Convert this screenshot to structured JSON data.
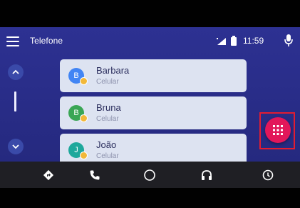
{
  "header": {
    "title": "Telefone",
    "time": "11:59",
    "menu_icon": "menu-icon",
    "signal_icon": "signal-icon",
    "battery_icon": "battery-icon",
    "mic_icon": "microphone-icon"
  },
  "scroll": {
    "up_icon": "chevron-up-icon",
    "down_icon": "chevron-down-icon"
  },
  "contacts": [
    {
      "name": "Barbara",
      "type": "Celular",
      "initial": "B",
      "color": "#4285f4"
    },
    {
      "name": "Bruna",
      "type": "Celular",
      "initial": "B",
      "color": "#3aa655"
    },
    {
      "name": "João",
      "type": "Celular",
      "initial": "J",
      "color": "#1ea89c"
    }
  ],
  "fab": {
    "icon": "dialpad-icon",
    "color": "#e2175a"
  },
  "nav": [
    {
      "icon": "navigation-icon"
    },
    {
      "icon": "phone-icon"
    },
    {
      "icon": "home-circle-icon"
    },
    {
      "icon": "headphones-icon"
    },
    {
      "icon": "recent-icon"
    }
  ]
}
